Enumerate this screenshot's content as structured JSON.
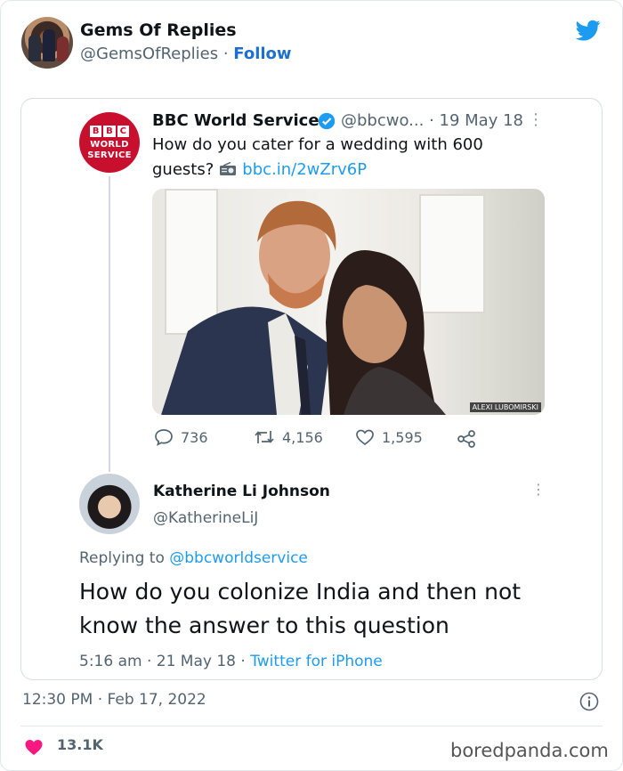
{
  "author": {
    "name": "Gems Of Replies",
    "handle": "@GemsOfReplies",
    "separator": " · ",
    "follow_label": "Follow"
  },
  "quoted": {
    "logo": {
      "bbc_letters": [
        "B",
        "B",
        "C"
      ],
      "line1": "WORLD",
      "line2": "SERVICE"
    },
    "name": "BBC World Service",
    "handle": "@bbcwo...",
    "date": "· 19 May 18",
    "more": "⋮",
    "text_line1": "How do you cater for a wedding with 600",
    "text_line2": "guests?",
    "link": "bbc.in/2wZrv6P",
    "photo_credit": "ALEXI LUBOMIRSKI",
    "replies": "736",
    "retweets": "4,156",
    "likes": "1,595"
  },
  "reply": {
    "name": "Katherine Li Johnson",
    "handle": "@KatherineLiJ",
    "more": "⋮",
    "replying_prefix": "Replying to ",
    "replying_to": "@bbcworldservice",
    "text_line1": "How do you colonize India and then not",
    "text_line2": "know the answer to this question",
    "time": "5:16 am · 21 May 18 · ",
    "source": "Twitter for iPhone"
  },
  "footer": {
    "timestamp": "12:30 PM · Feb 17, 2022",
    "likes": "13.1K",
    "watermark": "boredpanda.com"
  },
  "colors": {
    "twitter_blue": "#1d9bf0",
    "bbc_red": "#c8102e",
    "heart": "#f91880"
  }
}
